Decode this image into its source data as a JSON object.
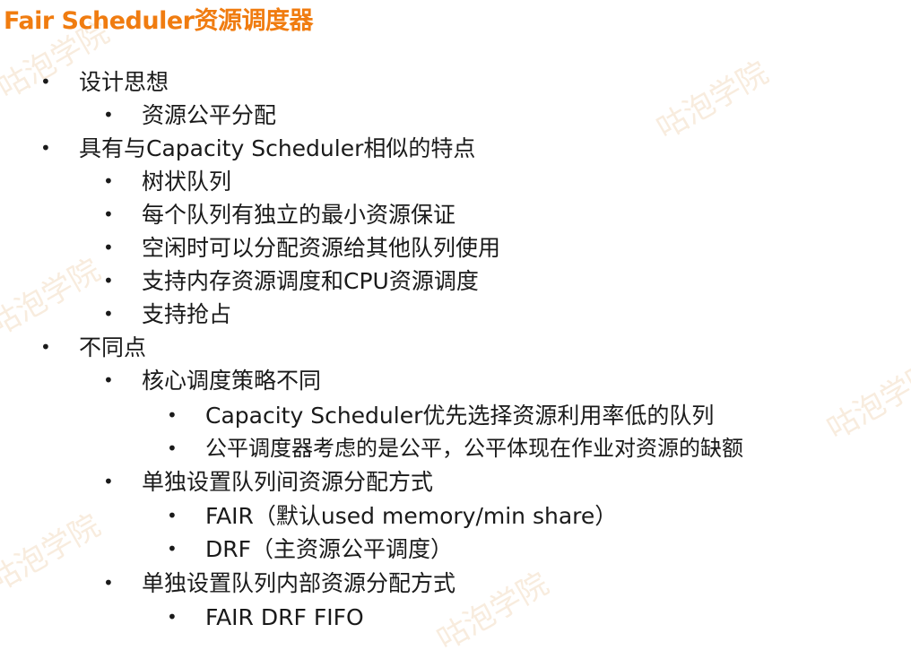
{
  "slide": {
    "title": "Fair Scheduler资源调度器",
    "bullet_glyph": "•",
    "items": [
      {
        "text": "设计思想",
        "level": 1
      },
      {
        "text": "资源公平分配",
        "level": 2
      },
      {
        "text": "具有与Capacity Scheduler相似的特点",
        "level": 1
      },
      {
        "text": "树状队列",
        "level": 2
      },
      {
        "text": "每个队列有独立的最小资源保证",
        "level": 2
      },
      {
        "text": "空闲时可以分配资源给其他队列使用",
        "level": 2
      },
      {
        "text": "支持内存资源调度和CPU资源调度",
        "level": 2
      },
      {
        "text": "支持抢占",
        "level": 2
      },
      {
        "text": "不同点",
        "level": 1
      },
      {
        "text": "核心调度策略不同",
        "level": 2
      },
      {
        "text": "Capacity Scheduler优先选择资源利用率低的队列",
        "level": 3
      },
      {
        "text": "公平调度器考虑的是公平，公平体现在作业对资源的缺额",
        "level": 3
      },
      {
        "text": "单独设置队列间资源分配方式",
        "level": 2
      },
      {
        "text": "FAIR（默认used memory/min share）",
        "level": 3
      },
      {
        "text": "DRF（主资源公平调度）",
        "level": 3
      },
      {
        "text": "单独设置队列内部资源分配方式",
        "level": 2
      },
      {
        "text": "FAIR DRF FIFO",
        "level": 3
      }
    ]
  },
  "watermark": {
    "text": "咕泡学院"
  },
  "colors": {
    "title": "#f07c10",
    "text": "#1a1a1a",
    "watermark": "#ecc8a0"
  }
}
